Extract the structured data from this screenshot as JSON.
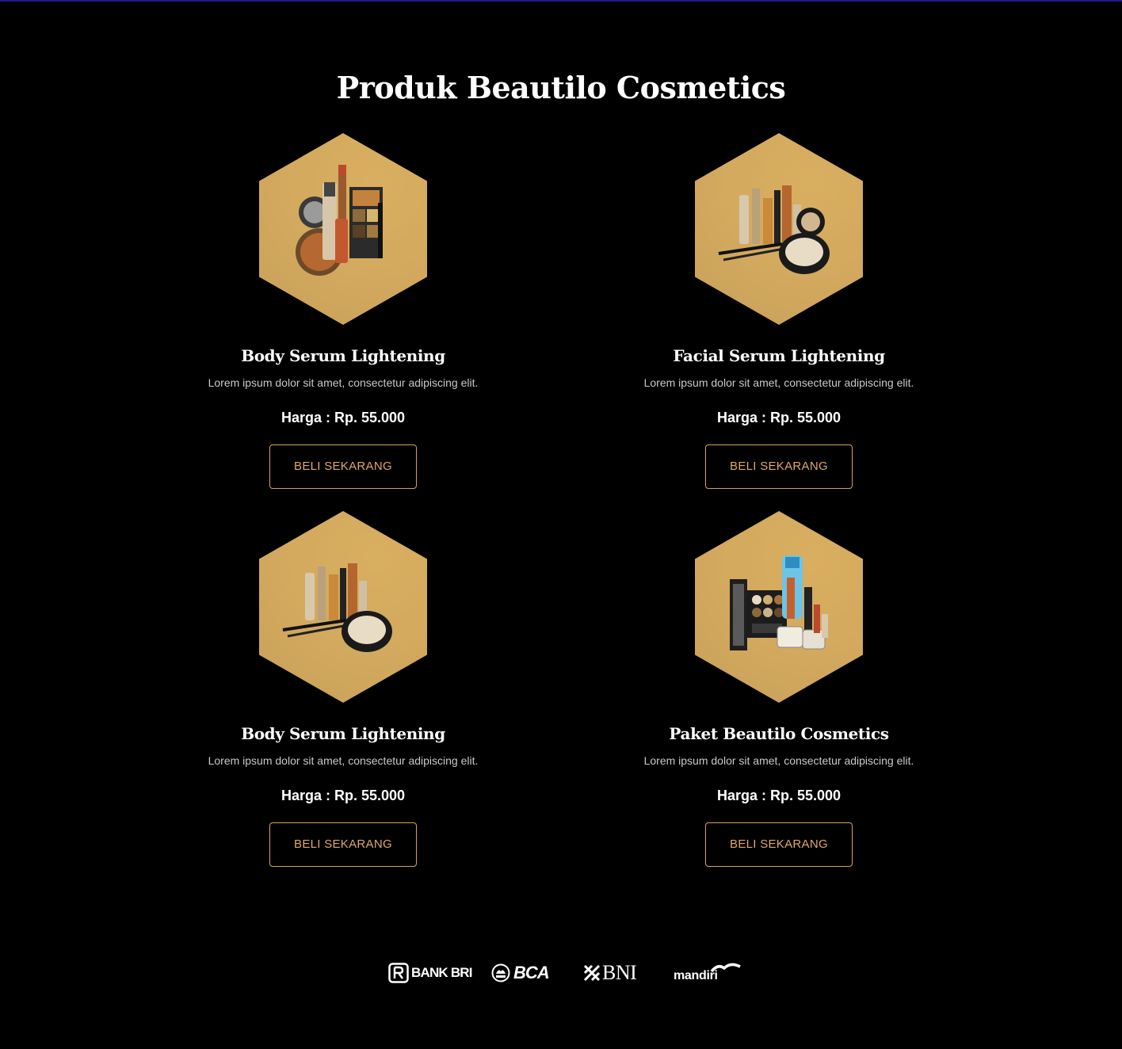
{
  "page": {
    "title": "Produk Beautilo Cosmetics"
  },
  "colors": {
    "background": "#000000",
    "hex_gold": "#d3aa5e",
    "button_border": "#d6a35c",
    "button_text": "#e0a866"
  },
  "products": [
    {
      "title": "Body Serum Lightening",
      "description": "Lorem ipsum dolor sit amet, consectetur adipiscing elit.",
      "price": "Harga : Rp. 55.000",
      "button_label": "BELI SEKARANG",
      "image_icon": "makeup-set-icon"
    },
    {
      "title": "Facial Serum Lightening",
      "description": "Lorem ipsum dolor sit amet, consectetur adipiscing elit.",
      "price": "Harga : Rp. 55.000",
      "button_label": "BELI SEKARANG",
      "image_icon": "makeup-set-icon"
    },
    {
      "title": "Body Serum Lightening",
      "description": "Lorem ipsum dolor sit amet, consectetur adipiscing elit.",
      "price": "Harga : Rp. 55.000",
      "button_label": "BELI SEKARANG",
      "image_icon": "makeup-set-icon"
    },
    {
      "title": "Paket Beautilo Cosmetics",
      "description": "Lorem ipsum dolor sit amet, consectetur adipiscing elit.",
      "price": "Harga : Rp. 55.000",
      "button_label": "BELI SEKARANG",
      "image_icon": "makeup-kit-icon"
    }
  ],
  "banks": [
    {
      "name": "BANK BRI",
      "icon": "bri-logo-icon"
    },
    {
      "name": "BCA",
      "icon": "bca-logo-icon"
    },
    {
      "name": "BNI",
      "icon": "bni-logo-icon"
    },
    {
      "name": "mandiri",
      "icon": "mandiri-logo-icon"
    }
  ]
}
